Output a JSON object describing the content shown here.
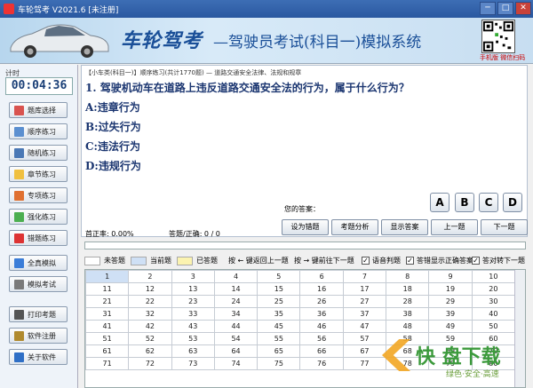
{
  "window": {
    "title": "车轮驾考 V2021.6 [未注册]",
    "min": "─",
    "max": "□",
    "close": "✕"
  },
  "banner": {
    "brand": "车轮驾考",
    "subtitle": "—驾驶员考试(科目一)模拟系统",
    "qr_caption": "手机版 微信扫码"
  },
  "timer": {
    "label": "计时",
    "value": "00:04:36"
  },
  "nav": [
    {
      "label": "题库选择",
      "icon": "grid-icon",
      "color": "#d9534f"
    },
    {
      "label": "顺序练习",
      "icon": "list-icon",
      "color": "#5b8fd0"
    },
    {
      "label": "随机练习",
      "icon": "shuffle-icon",
      "color": "#4a78b5"
    },
    {
      "label": "章节练习",
      "icon": "folder-icon",
      "color": "#f0c040"
    },
    {
      "label": "专项练习",
      "icon": "target-icon",
      "color": "#e07030"
    },
    {
      "label": "强化练习",
      "icon": "chart-icon",
      "color": "#4caf50"
    },
    {
      "label": "错题练习",
      "icon": "flag-icon",
      "color": "#d33"
    },
    {
      "label": "全真模拟",
      "icon": "monitor-icon",
      "color": "#3b7dd8"
    },
    {
      "label": "模拟考试",
      "icon": "document-icon",
      "color": "#7a7a7a"
    },
    {
      "label": "打印考题",
      "icon": "printer-icon",
      "color": "#555"
    },
    {
      "label": "软件注册",
      "icon": "key-icon",
      "color": "#b08a2e"
    },
    {
      "label": "关于软件",
      "icon": "info-icon",
      "color": "#2f6fc6"
    }
  ],
  "question": {
    "breadcrumb": "【小车类(科目一)】顺序练习(共计1770题) — 道路交通安全法律、法规和规章",
    "text": "1. 驾驶机动车在道路上违反道路交通安全法的行为，属于什么行为？",
    "options": [
      "A:违章行为",
      "B:过失行为",
      "C:违法行为",
      "D:违规行为"
    ]
  },
  "answer": {
    "label": "您的答案：",
    "choices": [
      "A",
      "B",
      "C",
      "D"
    ]
  },
  "stats": {
    "accuracy": "首正率: 0.00%",
    "count": "答题/正确: 0 / 0"
  },
  "actions": [
    "设为错题",
    "考题分析",
    "显示答案",
    "上一题",
    "下一题"
  ],
  "legend": {
    "unanswered": "未答题",
    "current": "当前题",
    "answered": "已答题",
    "key_prev": "按 ← 键返回上一题",
    "key_next": "按 → 键前往下一题",
    "voice": "语音判题",
    "show_correct": "答错显示正确答案",
    "auto_next": "答对转下一题",
    "check": "✓"
  },
  "grid": [
    [
      "1",
      "2",
      "3",
      "4",
      "5",
      "6",
      "7",
      "8",
      "9",
      "10"
    ],
    [
      "11",
      "12",
      "13",
      "14",
      "15",
      "16",
      "17",
      "18",
      "19",
      "20"
    ],
    [
      "21",
      "22",
      "23",
      "24",
      "25",
      "26",
      "27",
      "28",
      "29",
      "30"
    ],
    [
      "31",
      "32",
      "33",
      "34",
      "35",
      "36",
      "37",
      "38",
      "39",
      "40"
    ],
    [
      "41",
      "42",
      "43",
      "44",
      "45",
      "46",
      "47",
      "48",
      "49",
      "50"
    ],
    [
      "51",
      "52",
      "53",
      "54",
      "55",
      "56",
      "57",
      "58",
      "59",
      "60"
    ],
    [
      "61",
      "62",
      "63",
      "64",
      "65",
      "66",
      "67",
      "68",
      "69",
      "70"
    ],
    [
      "71",
      "72",
      "73",
      "74",
      "75",
      "76",
      "77",
      "78",
      "79",
      "80"
    ]
  ],
  "watermark": {
    "big": "快 盘下载",
    "small": "绿色·安全·高速"
  }
}
